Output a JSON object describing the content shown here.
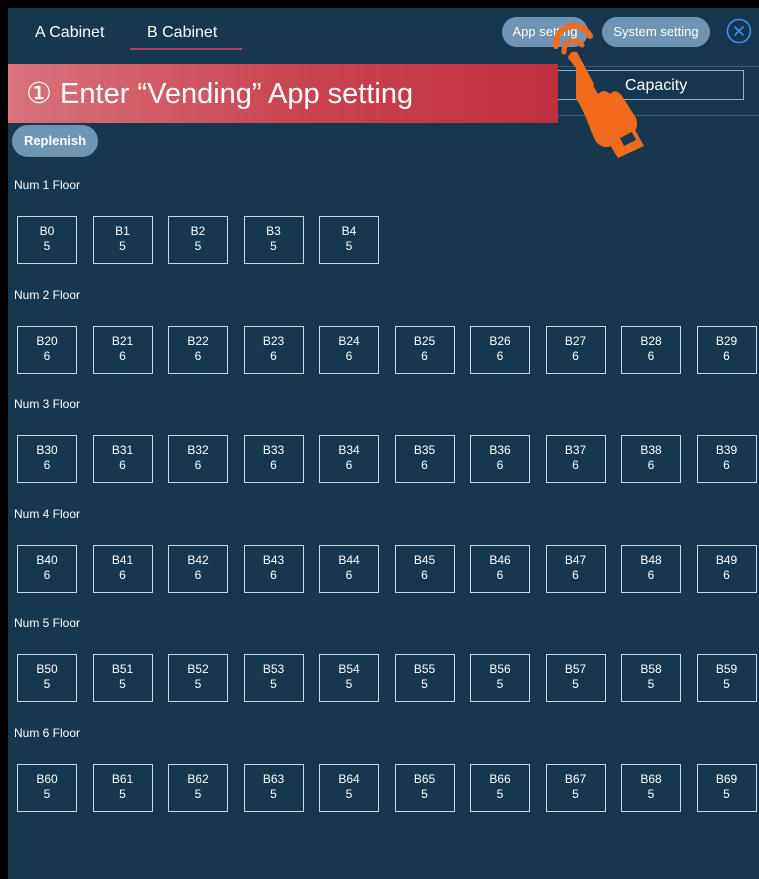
{
  "header": {
    "tabs": [
      {
        "label": "A Cabinet"
      },
      {
        "label": "B Cabinet",
        "active": true
      }
    ],
    "app_setting_label": "App setting",
    "system_setting_label": "System setting",
    "close_icon": "close-circle-icon"
  },
  "capacity": {
    "label": "Capacity"
  },
  "replenish_label": "Replenish",
  "floors": [
    {
      "label": "Num 1 Floor",
      "slots": [
        {
          "id": "B0",
          "qty": "5"
        },
        {
          "id": "B1",
          "qty": "5"
        },
        {
          "id": "B2",
          "qty": "5"
        },
        {
          "id": "B3",
          "qty": "5"
        },
        {
          "id": "B4",
          "qty": "5"
        }
      ]
    },
    {
      "label": "Num 2 Floor",
      "slots": [
        {
          "id": "B20",
          "qty": "6"
        },
        {
          "id": "B21",
          "qty": "6"
        },
        {
          "id": "B22",
          "qty": "6"
        },
        {
          "id": "B23",
          "qty": "6"
        },
        {
          "id": "B24",
          "qty": "6"
        },
        {
          "id": "B25",
          "qty": "6"
        },
        {
          "id": "B26",
          "qty": "6"
        },
        {
          "id": "B27",
          "qty": "6"
        },
        {
          "id": "B28",
          "qty": "6"
        },
        {
          "id": "B29",
          "qty": "6"
        }
      ]
    },
    {
      "label": "Num 3 Floor",
      "slots": [
        {
          "id": "B30",
          "qty": "6"
        },
        {
          "id": "B31",
          "qty": "6"
        },
        {
          "id": "B32",
          "qty": "6"
        },
        {
          "id": "B33",
          "qty": "6"
        },
        {
          "id": "B34",
          "qty": "6"
        },
        {
          "id": "B35",
          "qty": "6"
        },
        {
          "id": "B36",
          "qty": "6"
        },
        {
          "id": "B37",
          "qty": "6"
        },
        {
          "id": "B38",
          "qty": "6"
        },
        {
          "id": "B39",
          "qty": "6"
        }
      ]
    },
    {
      "label": "Num 4 Floor",
      "slots": [
        {
          "id": "B40",
          "qty": "6"
        },
        {
          "id": "B41",
          "qty": "6"
        },
        {
          "id": "B42",
          "qty": "6"
        },
        {
          "id": "B43",
          "qty": "6"
        },
        {
          "id": "B44",
          "qty": "6"
        },
        {
          "id": "B45",
          "qty": "6"
        },
        {
          "id": "B46",
          "qty": "6"
        },
        {
          "id": "B47",
          "qty": "6"
        },
        {
          "id": "B48",
          "qty": "6"
        },
        {
          "id": "B49",
          "qty": "6"
        }
      ]
    },
    {
      "label": "Num 5 Floor",
      "slots": [
        {
          "id": "B50",
          "qty": "5"
        },
        {
          "id": "B51",
          "qty": "5"
        },
        {
          "id": "B52",
          "qty": "5"
        },
        {
          "id": "B53",
          "qty": "5"
        },
        {
          "id": "B54",
          "qty": "5"
        },
        {
          "id": "B55",
          "qty": "5"
        },
        {
          "id": "B56",
          "qty": "5"
        },
        {
          "id": "B57",
          "qty": "5"
        },
        {
          "id": "B58",
          "qty": "5"
        },
        {
          "id": "B59",
          "qty": "5"
        }
      ]
    },
    {
      "label": "Num 6 Floor",
      "slots": [
        {
          "id": "B60",
          "qty": "5"
        },
        {
          "id": "B61",
          "qty": "5"
        },
        {
          "id": "B62",
          "qty": "5"
        },
        {
          "id": "B63",
          "qty": "5"
        },
        {
          "id": "B64",
          "qty": "5"
        },
        {
          "id": "B65",
          "qty": "5"
        },
        {
          "id": "B66",
          "qty": "5"
        },
        {
          "id": "B67",
          "qty": "5"
        },
        {
          "id": "B68",
          "qty": "5"
        },
        {
          "id": "B69",
          "qty": "5"
        }
      ]
    }
  ],
  "overlay": {
    "instruction": "① Enter “Vending” App setting",
    "pointer_icon": "hand-pointer-icon"
  },
  "colors": {
    "background": "#16374e",
    "button": "#6f95b3",
    "tab_underline": "#b04060",
    "banner": "#c9434e",
    "hand": "#f26a1b"
  }
}
